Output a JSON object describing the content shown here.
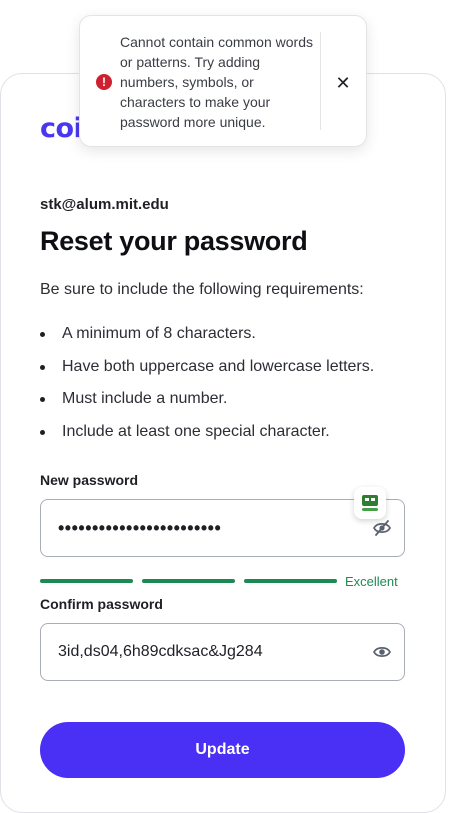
{
  "brand": {
    "logo_text": "coi",
    "color": "#4a37f0"
  },
  "toast": {
    "icon": "error-icon",
    "icon_glyph": "!",
    "message": "Cannot contain common words or patterns. Try adding numbers, symbols, or characters to make your password more unique.",
    "close_glyph": "✕"
  },
  "account": {
    "email": "stk@alum.mit.edu"
  },
  "page": {
    "title": "Reset your password",
    "intro": "Be sure to include the following requirements:",
    "requirements": [
      "A minimum of 8 characters.",
      "Have both uppercase and lowercase letters.",
      "Must include a number.",
      "Include at least one special character."
    ]
  },
  "new_password": {
    "label": "New password",
    "masked_value": "••••••••••••••••••••••••",
    "toggle_icon": "eye-off-icon",
    "strength_segments_filled": 3,
    "strength_segments_total": 3,
    "strength_label": "Excellent",
    "strength_color": "#1e8a53"
  },
  "confirm_password": {
    "label": "Confirm password",
    "value": "3id,ds04,6h89cdksac&Jg284",
    "toggle_icon": "eye-icon"
  },
  "actions": {
    "update_label": "Update",
    "button_color": "#4a2ff4"
  }
}
